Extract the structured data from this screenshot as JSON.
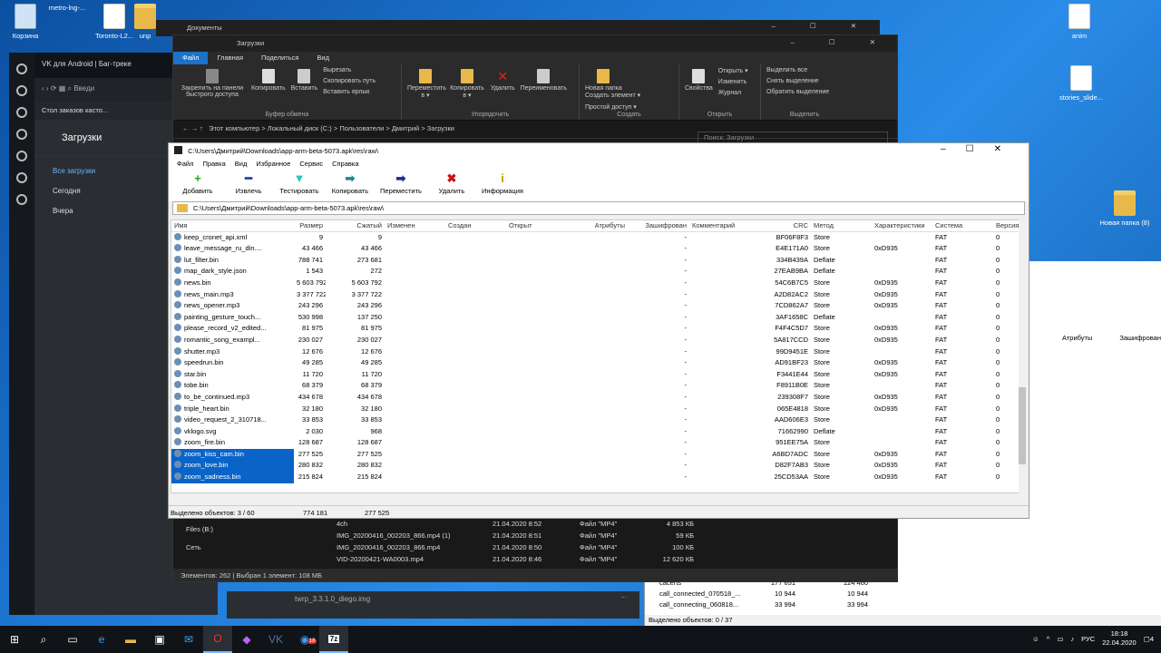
{
  "desktop": {
    "icons": [
      {
        "label": "Корзина",
        "kind": "bin"
      },
      {
        "label": "metro-lng-...",
        "kind": "zip"
      },
      {
        "label": "Toronto-L2...",
        "kind": "doc"
      },
      {
        "label": "unp",
        "kind": "folder"
      },
      {
        "label": "anim",
        "kind": "doc"
      },
      {
        "label": "stories_slide...",
        "kind": "doc"
      },
      {
        "label": "Новая папка (8)",
        "kind": "folder"
      }
    ]
  },
  "opera": {
    "tab_title": "VK для Android | Баг-треке",
    "address_partial": "Введи",
    "bookmark": "Стол заказов касто...",
    "page_title": "Загрузки",
    "nav": [
      "Все загрузки",
      "Сегодня",
      "Вчера"
    ],
    "bottom_file": "twrp_3.3.1.0_diego.img",
    "more": "..."
  },
  "explorer_back": {
    "title": "Документы"
  },
  "explorer": {
    "title": "Загрузки",
    "tabs": [
      "Файл",
      "Главная",
      "Поделиться",
      "Вид"
    ],
    "groups": [
      {
        "label": "Буфер обмена",
        "buttons": [
          "Закрепить на панели быстрого доступа",
          "Копировать",
          "Вставить"
        ],
        "small": [
          "Вырезать",
          "Скопировать путь",
          "Вставить ярлык"
        ]
      },
      {
        "label": "Упорядочить",
        "buttons": [
          "Переместить в ▾",
          "Копировать в ▾",
          "Удалить",
          "Переименовать"
        ],
        "small": []
      },
      {
        "label": "Создать",
        "buttons": [
          "Новая папка"
        ],
        "small": [
          "Создать элемент ▾",
          "Простой доступ ▾"
        ]
      },
      {
        "label": "Открыть",
        "buttons": [
          "Свойства"
        ],
        "small": [
          "Открыть ▾",
          "Изменить",
          "Журнал"
        ]
      },
      {
        "label": "Выделить",
        "buttons": [],
        "small": [
          "Выделить все",
          "Снять выделение",
          "Обратить выделение"
        ]
      }
    ],
    "breadcrumb": "Этот компьютер  >  Локальный диск (C:)  >  Пользователи  >  Дмитрий  >  Загрузки",
    "search_placeholder": "Поиск: Загрузки",
    "tree": [
      "Files (B:)",
      "Сеть"
    ],
    "files": [
      {
        "name": "4ch",
        "date": "21.04.2020 8:52",
        "type": "Файл \"MP4\"",
        "size": "4 853 КБ"
      },
      {
        "name": "IMG_20200416_002203_866.mp4 (1)",
        "date": "21.04.2020 8:51",
        "type": "Файл \"MP4\"",
        "size": "59 КБ"
      },
      {
        "name": "IMG_20200416_002203_866.mp4",
        "date": "21.04.2020 8:50",
        "type": "Файл \"MP4\"",
        "size": "100 КБ"
      },
      {
        "name": "VID-20200421-WA0003.mp4",
        "date": "21.04.2020 8:46",
        "type": "Файл \"MP4\"",
        "size": "12 620 КБ"
      }
    ],
    "status": "Элементов: 262   |   Выбран 1 элемент: 108 МБ"
  },
  "zip": {
    "title": "C:\\Users\\Дмитрий\\Downloads\\app-arm-beta-5073.apk\\res\\raw\\",
    "menu": [
      "Файл",
      "Правка",
      "Вид",
      "Избранное",
      "Сервис",
      "Справка"
    ],
    "toolbar": [
      {
        "label": "Добавить",
        "sym": "+",
        "color": "#1fa81f"
      },
      {
        "label": "Извлечь",
        "sym": "━",
        "color": "#1a3fb0"
      },
      {
        "label": "Тестировать",
        "sym": "▼",
        "color": "#33c0c0"
      },
      {
        "label": "Копировать",
        "sym": "➡",
        "color": "#1a8a8a"
      },
      {
        "label": "Переместить",
        "sym": "➡",
        "color": "#1a2a90"
      },
      {
        "label": "Удалить",
        "sym": "✖",
        "color": "#d01010"
      },
      {
        "label": "Информация",
        "sym": "i",
        "color": "#c0a000"
      }
    ],
    "address": "C:\\Users\\Дмитрий\\Downloads\\app-arm-beta-5073.apk\\res\\raw\\",
    "columns": [
      "Имя",
      "Размер",
      "Сжатый",
      "Изменен",
      "Создан",
      "Открыт",
      "Атрибуты",
      "Зашифрован",
      "Комментарий",
      "CRC",
      "Метод",
      "Характеристики",
      "Система",
      "Версия"
    ],
    "rows": [
      [
        "keep_cronet_api.xml",
        "9",
        "9",
        "-",
        "BF06F8F3",
        "Store",
        "",
        "FAT",
        "0"
      ],
      [
        "leave_message_ru_din....",
        "43 466",
        "43 466",
        "-",
        "E4E171A0",
        "Store",
        "0xD935",
        "FAT",
        "0"
      ],
      [
        "lut_filter.bin",
        "788 741",
        "273 681",
        "-",
        "334B439A",
        "Deflate",
        "",
        "FAT",
        "0"
      ],
      [
        "map_dark_style.json",
        "1 543",
        "272",
        "-",
        "27EAB9BA",
        "Deflate",
        "",
        "FAT",
        "0"
      ],
      [
        "news.bin",
        "5 603 792",
        "5 603 792",
        "-",
        "54C6B7C5",
        "Store",
        "0xD935",
        "FAT",
        "0"
      ],
      [
        "news_main.mp3",
        "3 377 722",
        "3 377 722",
        "-",
        "A2D82AC2",
        "Store",
        "0xD935",
        "FAT",
        "0"
      ],
      [
        "news_opener.mp3",
        "243 296",
        "243 296",
        "-",
        "7CD862A7",
        "Store",
        "0xD935",
        "FAT",
        "0"
      ],
      [
        "painting_gesture_touch...",
        "530 998",
        "137 250",
        "-",
        "3AF1658C",
        "Deflate",
        "",
        "FAT",
        "0"
      ],
      [
        "please_record_v2_edited...",
        "81 975",
        "81 975",
        "-",
        "F4F4C5D7",
        "Store",
        "0xD935",
        "FAT",
        "0"
      ],
      [
        "romantic_song_exampl...",
        "230 027",
        "230 027",
        "-",
        "5A817CCD",
        "Store",
        "0xD935",
        "FAT",
        "0"
      ],
      [
        "shutter.mp3",
        "12 676",
        "12 676",
        "-",
        "99D9451E",
        "Store",
        "",
        "FAT",
        "0"
      ],
      [
        "speedrun.bin",
        "49 285",
        "49 285",
        "-",
        "AD91BF23",
        "Store",
        "0xD935",
        "FAT",
        "0"
      ],
      [
        "star.bin",
        "11 720",
        "11 720",
        "-",
        "F3441E44",
        "Store",
        "0xD935",
        "FAT",
        "0"
      ],
      [
        "tobe.bin",
        "68 379",
        "68 379",
        "-",
        "F8911B0E",
        "Store",
        "",
        "FAT",
        "0"
      ],
      [
        "to_be_continued.mp3",
        "434 678",
        "434 678",
        "-",
        "239308F7",
        "Store",
        "0xD935",
        "FAT",
        "0"
      ],
      [
        "triple_heart.bin",
        "32 180",
        "32 180",
        "-",
        "065E4818",
        "Store",
        "0xD935",
        "FAT",
        "0"
      ],
      [
        "video_request_2_310718...",
        "33 853",
        "33 853",
        "-",
        "AAD606E3",
        "Store",
        "",
        "FAT",
        "0"
      ],
      [
        "vklogo.svg",
        "2 030",
        "968",
        "-",
        "71662990",
        "Deflate",
        "",
        "FAT",
        "0"
      ],
      [
        "zoom_fire.bin",
        "128 687",
        "128 687",
        "-",
        "951EE75A",
        "Store",
        "",
        "FAT",
        "0"
      ],
      [
        "zoom_kiss_cam.bin",
        "277 525",
        "277 525",
        "-",
        "A6BD7ADC",
        "Store",
        "0xD935",
        "FAT",
        "0"
      ],
      [
        "zoom_love.bin",
        "280 832",
        "280 832",
        "-",
        "D82F7AB3",
        "Store",
        "0xD935",
        "FAT",
        "0"
      ],
      [
        "zoom_sadness.bin",
        "215 824",
        "215 824",
        "-",
        "25CD53AA",
        "Store",
        "0xD935",
        "FAT",
        "0"
      ]
    ],
    "selected": [
      19,
      20,
      21
    ],
    "status": {
      "selected": "Выделено объектов: 3 / 60",
      "size": "774 181",
      "packed": "277 525"
    }
  },
  "bgzip": {
    "header": [
      "Атрибуты",
      "Зашифрован"
    ],
    "rows": [
      [
        "cacerts",
        "177 651",
        "124 460"
      ],
      [
        "call_connected_070518_...",
        "10 944",
        "10 944"
      ],
      [
        "call_connecting_060818...",
        "33 994",
        "33 994"
      ]
    ],
    "status": "Выделено объектов: 0 / 37"
  },
  "taskbar": {
    "lang": "РУС",
    "time": "18:18",
    "date": "22.04.2020",
    "notifications": "4",
    "badge": "18"
  }
}
